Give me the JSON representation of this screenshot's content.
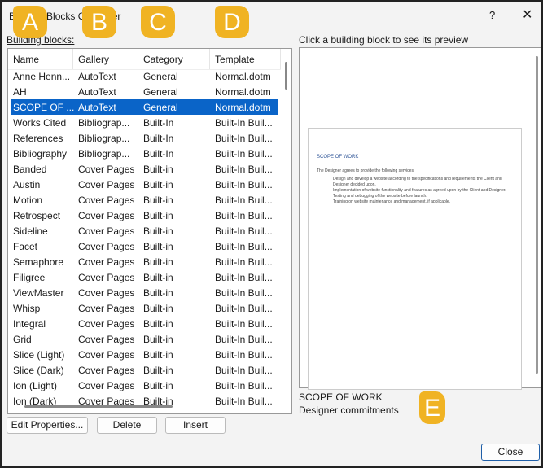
{
  "window": {
    "title": "Building Blocks Organizer",
    "help": "?",
    "close": "✕"
  },
  "list": {
    "label": "Building blocks:",
    "columns": [
      "Name",
      "Gallery",
      "Category",
      "Template"
    ],
    "rows": [
      [
        "Anne Henn...",
        "AutoText",
        "General",
        "Normal.dotm"
      ],
      [
        "AH",
        "AutoText",
        "General",
        "Normal.dotm"
      ],
      [
        "SCOPE OF ...",
        "AutoText",
        "General",
        "Normal.dotm"
      ],
      [
        "Works Cited",
        "Bibliograp...",
        "Built-In",
        "Built-In Buil..."
      ],
      [
        "References",
        "Bibliograp...",
        "Built-In",
        "Built-In Buil..."
      ],
      [
        "Bibliography",
        "Bibliograp...",
        "Built-In",
        "Built-In Buil..."
      ],
      [
        "Banded",
        "Cover Pages",
        "Built-in",
        "Built-In Buil..."
      ],
      [
        "Austin",
        "Cover Pages",
        "Built-in",
        "Built-In Buil..."
      ],
      [
        "Motion",
        "Cover Pages",
        "Built-in",
        "Built-In Buil..."
      ],
      [
        "Retrospect",
        "Cover Pages",
        "Built-in",
        "Built-In Buil..."
      ],
      [
        "Sideline",
        "Cover Pages",
        "Built-in",
        "Built-In Buil..."
      ],
      [
        "Facet",
        "Cover Pages",
        "Built-in",
        "Built-In Buil..."
      ],
      [
        "Semaphore",
        "Cover Pages",
        "Built-in",
        "Built-In Buil..."
      ],
      [
        "Filigree",
        "Cover Pages",
        "Built-in",
        "Built-In Buil..."
      ],
      [
        "ViewMaster",
        "Cover Pages",
        "Built-in",
        "Built-In Buil..."
      ],
      [
        "Whisp",
        "Cover Pages",
        "Built-in",
        "Built-In Buil..."
      ],
      [
        "Integral",
        "Cover Pages",
        "Built-in",
        "Built-In Buil..."
      ],
      [
        "Grid",
        "Cover Pages",
        "Built-in",
        "Built-In Buil..."
      ],
      [
        "Slice (Light)",
        "Cover Pages",
        "Built-in",
        "Built-In Buil..."
      ],
      [
        "Slice (Dark)",
        "Cover Pages",
        "Built-in",
        "Built-In Buil..."
      ],
      [
        "Ion (Light)",
        "Cover Pages",
        "Built-in",
        "Built-In Buil..."
      ],
      [
        "Ion (Dark)",
        "Cover Pages",
        "Built-in",
        "Built-In Buil..."
      ]
    ],
    "selected_index": 2
  },
  "preview": {
    "label": "Click a building block to see its preview",
    "doc_title": "SCOPE OF WORK",
    "doc_intro": "The Designer agrees to provide the following services:",
    "doc_items": [
      "Design and develop a website according to the specifications and requirements the Client and Designer decided upon.",
      "Implementation of website functionality and features as agreed upon by the Client and Designer.",
      "Testing and debugging of the website before launch.",
      "Training on website maintenance and management, if applicable."
    ],
    "name": "SCOPE OF WORK",
    "description": "Designer commitments"
  },
  "buttons": {
    "edit": "Edit Properties...",
    "delete": "Delete",
    "insert": "Insert",
    "close": "Close"
  },
  "callouts": [
    "A",
    "B",
    "C",
    "D",
    "E"
  ],
  "colors": {
    "callout": "#f0b323",
    "selection": "#0a64c8"
  }
}
